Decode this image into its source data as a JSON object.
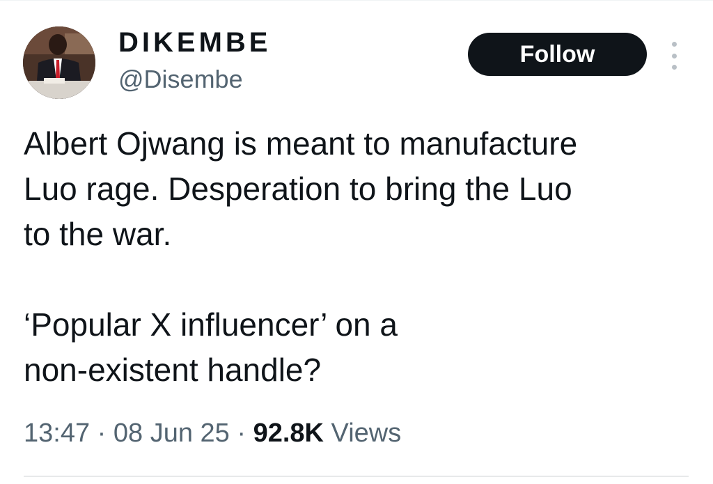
{
  "author": {
    "display_name": "DIKEMBE",
    "handle": "@Disembe",
    "avatar_icon": "profile-photo"
  },
  "actions": {
    "follow_label": "Follow",
    "more_icon": "more-vertical-icon"
  },
  "tweet": {
    "lines": [
      "Albert Ojwang is meant to manufacture",
      "Luo rage. Desperation to bring the Luo",
      "to the war.",
      "",
      "‘Popular X influencer’ on a",
      "non-existent handle?"
    ],
    "time": "13:47",
    "date": "08 Jun 25",
    "separator": "·",
    "views_count": "92.8K",
    "views_label": "Views"
  },
  "colors": {
    "text": "#0f1419",
    "secondary": "#536471",
    "button_bg": "#0f1419",
    "button_text": "#ffffff"
  }
}
